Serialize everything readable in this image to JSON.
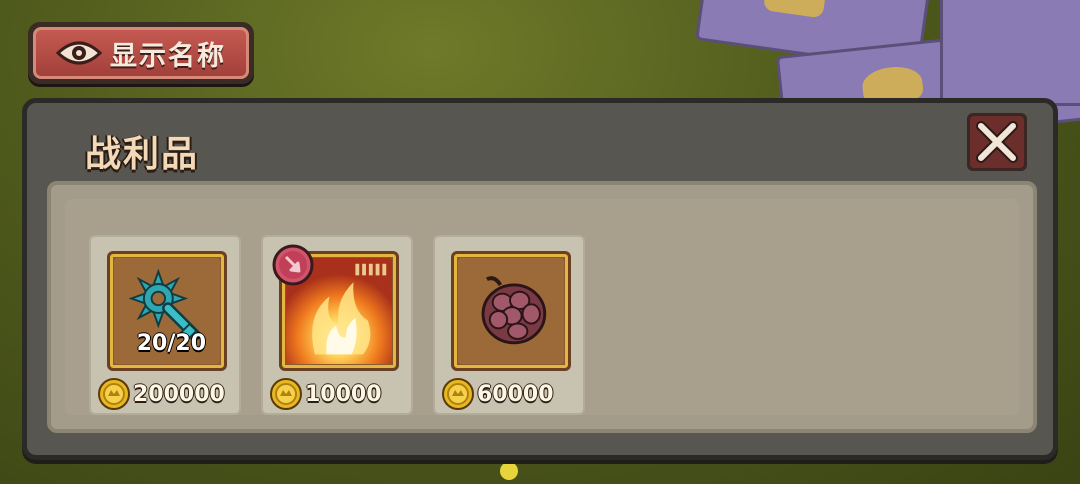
{
  "toggle": {
    "label": "显示名称",
    "icon": "eye-icon"
  },
  "panel": {
    "title": "战利品",
    "close_icon": "close-icon",
    "items": [
      {
        "icon": "spiked-key-icon",
        "count": "20/20",
        "price": "200000"
      },
      {
        "icon": "fire-flame-icon",
        "badge_icon": "pink-badge-icon",
        "price": "10000"
      },
      {
        "icon": "meat-chunk-icon",
        "price": "60000"
      }
    ]
  },
  "colors": {
    "button_red": "#b84a43",
    "panel_bg": "#585651",
    "content_bg": "#a8a08d",
    "title_text": "#f3d9b8",
    "gold": "#e2b640"
  }
}
